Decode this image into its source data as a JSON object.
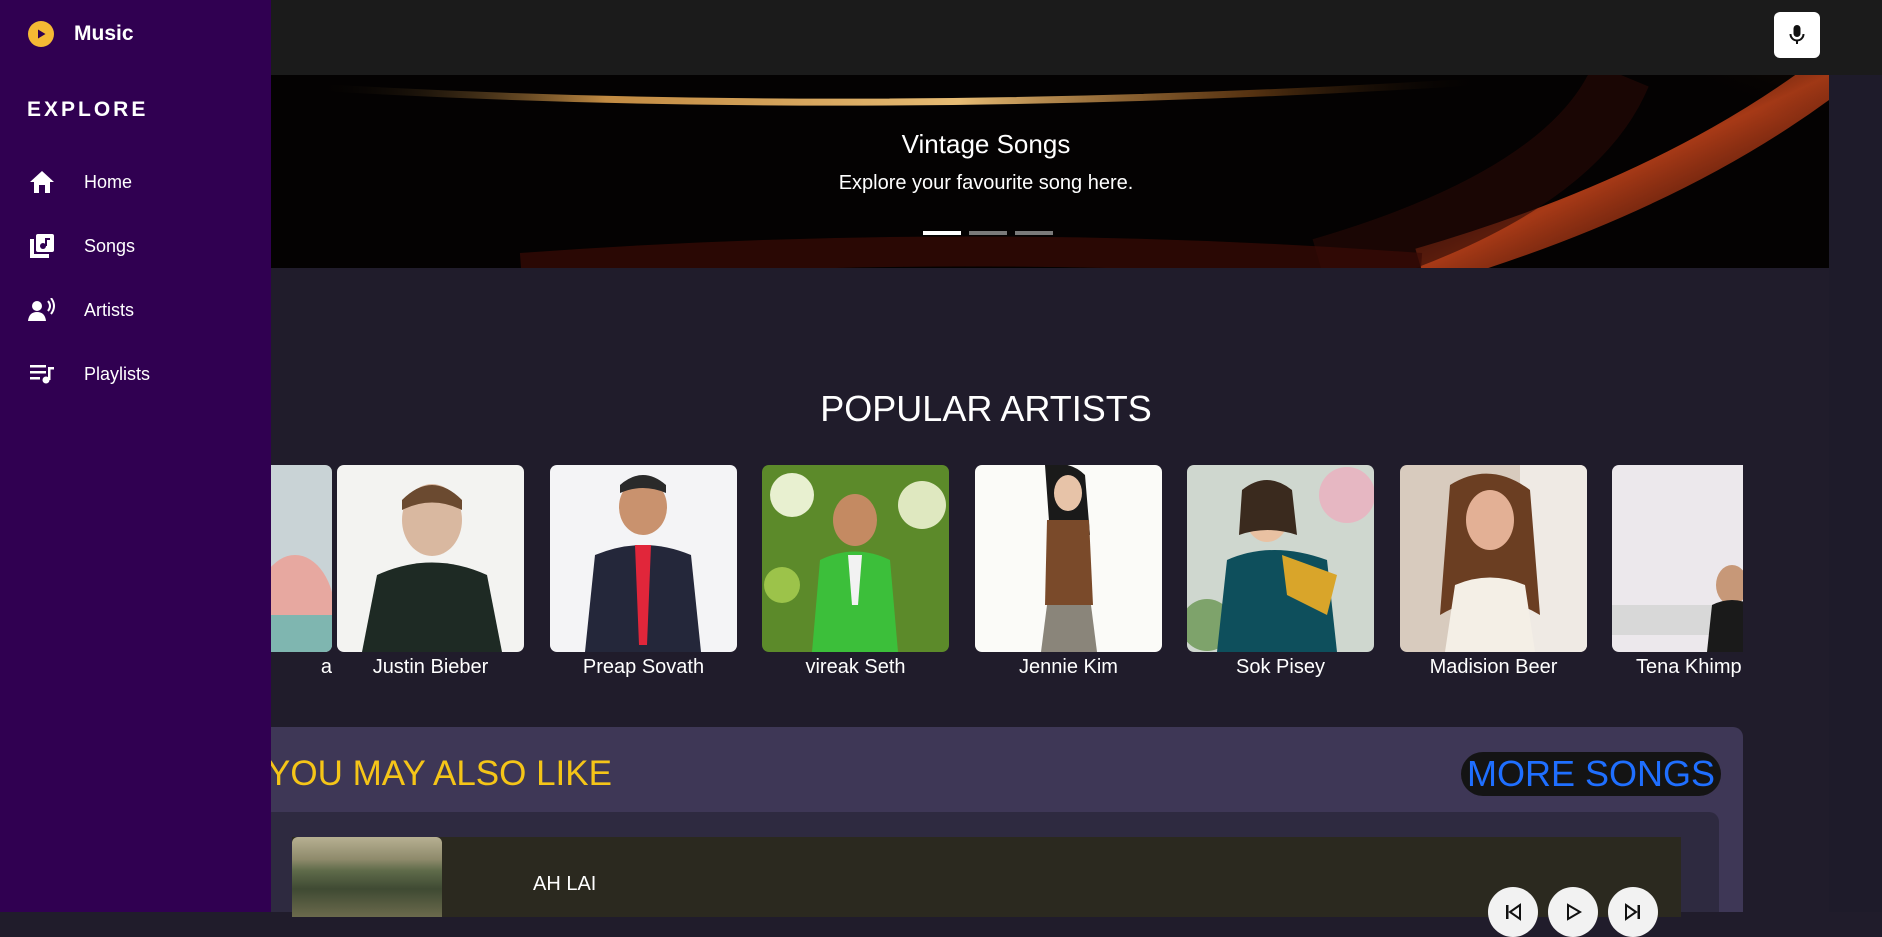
{
  "app": {
    "brand_label": "Music"
  },
  "sidebar": {
    "section_label": "EXPLORE",
    "items": [
      {
        "label": "Home",
        "icon": "home-icon"
      },
      {
        "label": "Songs",
        "icon": "library-music-icon"
      },
      {
        "label": "Artists",
        "icon": "record-voice-icon"
      },
      {
        "label": "Playlists",
        "icon": "queue-music-icon"
      }
    ]
  },
  "topbar": {
    "mic_icon": "microphone-icon"
  },
  "hero": {
    "title": "Vintage Songs",
    "subtitle": "Explore your favourite song here.",
    "slide_count": 3,
    "active_slide": 1
  },
  "popular": {
    "title": "POPULAR ARTISTS",
    "artists": [
      {
        "name": "a"
      },
      {
        "name": "Justin Bieber"
      },
      {
        "name": "Preap Sovath"
      },
      {
        "name": "vireak Seth"
      },
      {
        "name": "Jennie Kim"
      },
      {
        "name": "Sok Pisey"
      },
      {
        "name": "Madision Beer"
      },
      {
        "name": "Tena Khimphun"
      }
    ]
  },
  "also_like": {
    "title": "YOU MAY ALSO LIKE",
    "more_label": "MORE SONGS",
    "songs": [
      {
        "title": "AH LAI"
      }
    ]
  },
  "colors": {
    "sidebar_bg": "#300051",
    "page_bg": "#201c2b",
    "accent_yellow": "#f5c518",
    "link_blue": "#1f6fff",
    "brand_icon": "#f5b934"
  }
}
